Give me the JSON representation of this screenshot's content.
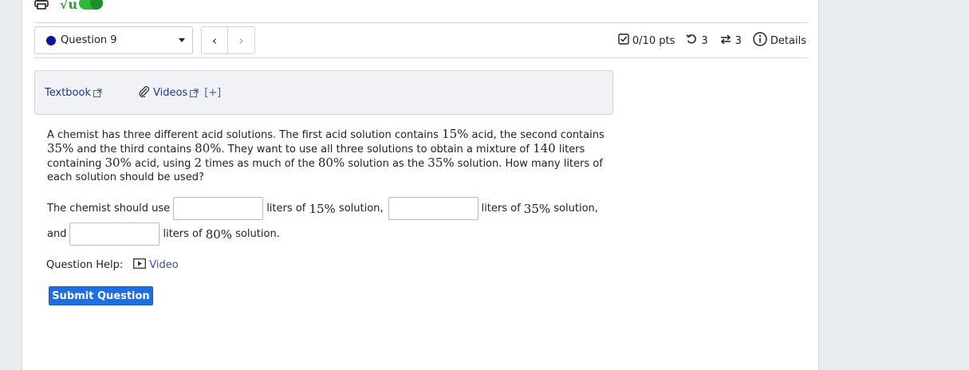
{
  "toolbar": {
    "print_icon": "printer-icon",
    "math_icon_text": "√u",
    "toggle_state": "on"
  },
  "question_select": {
    "label": "Question 9",
    "dot_color": "#12129a"
  },
  "nav": {
    "prev_glyph": "‹",
    "next_glyph": "›"
  },
  "status": {
    "score": "0/10 pts",
    "retries": "3",
    "attempts": "3",
    "details_label": "Details"
  },
  "resources": {
    "textbook": "Textbook",
    "videos": "Videos",
    "more": "[+]"
  },
  "question": {
    "p1": "A chemist has three different acid solutions. The first acid solution contains ",
    "m1": "15%",
    "p2": " acid, the second contains ",
    "m2": "35%",
    "p3": " and the third contains ",
    "m3": "80%",
    "p4": ". They want to use all three solutions to obtain a mixture of ",
    "m4": "140",
    "p5": " liters containing ",
    "m5": "30%",
    "p6": " acid, using ",
    "m6": "2",
    "p7": " times as much of the ",
    "m7": "80%",
    "p8": " solution as the ",
    "m8": "35%",
    "p9": " solution. How many liters of each solution should be used?"
  },
  "answer": {
    "lead": "The chemist should use",
    "liters_of": "liters of",
    "p15": "15%",
    "p35": "35%",
    "p80": "80%",
    "solution_comma": "solution,",
    "solution_end": "solution.",
    "and": "and",
    "input1": "",
    "input2": "",
    "input3": ""
  },
  "help": {
    "label": "Question Help:",
    "video": "Video"
  },
  "submit_label": "Submit Question",
  "colors": {
    "accent": "#1e6ee3",
    "link": "#1d3a8e",
    "toggle": "#2eb83a"
  }
}
